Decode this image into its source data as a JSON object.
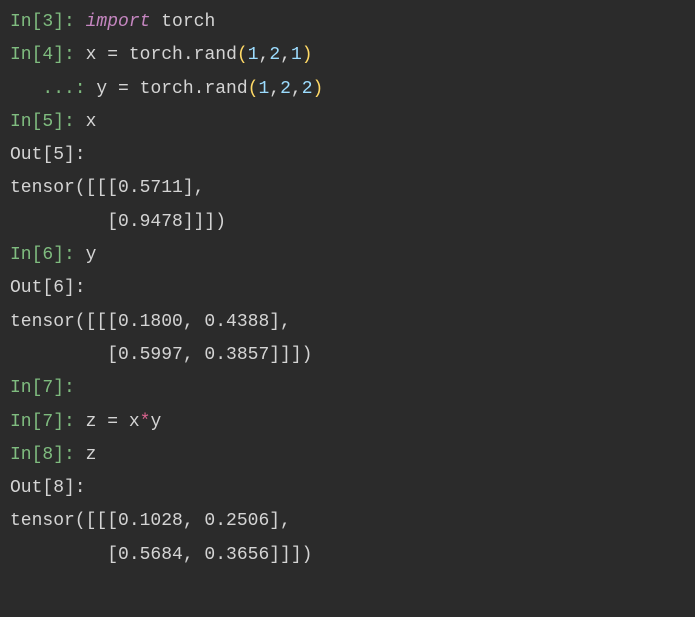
{
  "lines": {
    "l1_prompt": "In[3]: ",
    "l1_import": "import",
    "l1_sp": " ",
    "l1_torch": "torch",
    "l2_prompt": "In[4]: ",
    "l2_x": "x ",
    "l2_eq": "=",
    "l2_sp": " torch.rand",
    "l2_p1": "(",
    "l2_n1": "1",
    "l2_c1": ",",
    "l2_n2": "2",
    "l2_c2": ",",
    "l2_n3": "1",
    "l2_p2": ")",
    "l3_prompt": "   ...: ",
    "l3_y": "y ",
    "l3_eq": "=",
    "l3_sp": " torch.rand",
    "l3_p1": "(",
    "l3_n1": "1",
    "l3_c1": ",",
    "l3_n2": "2",
    "l3_c2": ",",
    "l3_n3": "2",
    "l3_p2": ")",
    "l4_prompt": "In[5]: ",
    "l4_x": "x",
    "l5_prompt": "Out[5]:",
    "l6_text": "tensor([[[0.5711],",
    "l7_text": "         [0.9478]]])",
    "l8_prompt": "In[6]: ",
    "l8_y": "y",
    "l9_prompt": "Out[6]:",
    "l10_text": "tensor([[[0.1800, 0.4388],",
    "l11_text": "         [0.5997, 0.3857]]])",
    "l12_prompt": "In[7]:",
    "l13_prompt": "In[7]: ",
    "l13_z": "z ",
    "l13_eq": "=",
    "l13_sp": " x",
    "l13_star": "*",
    "l13_y": "y",
    "l14_prompt": "In[8]: ",
    "l14_z": "z",
    "l15_prompt": "Out[8]:",
    "l16_text": "tensor([[[0.1028, 0.2506],",
    "l17_text": "         [0.5684, 0.3656]]])"
  }
}
